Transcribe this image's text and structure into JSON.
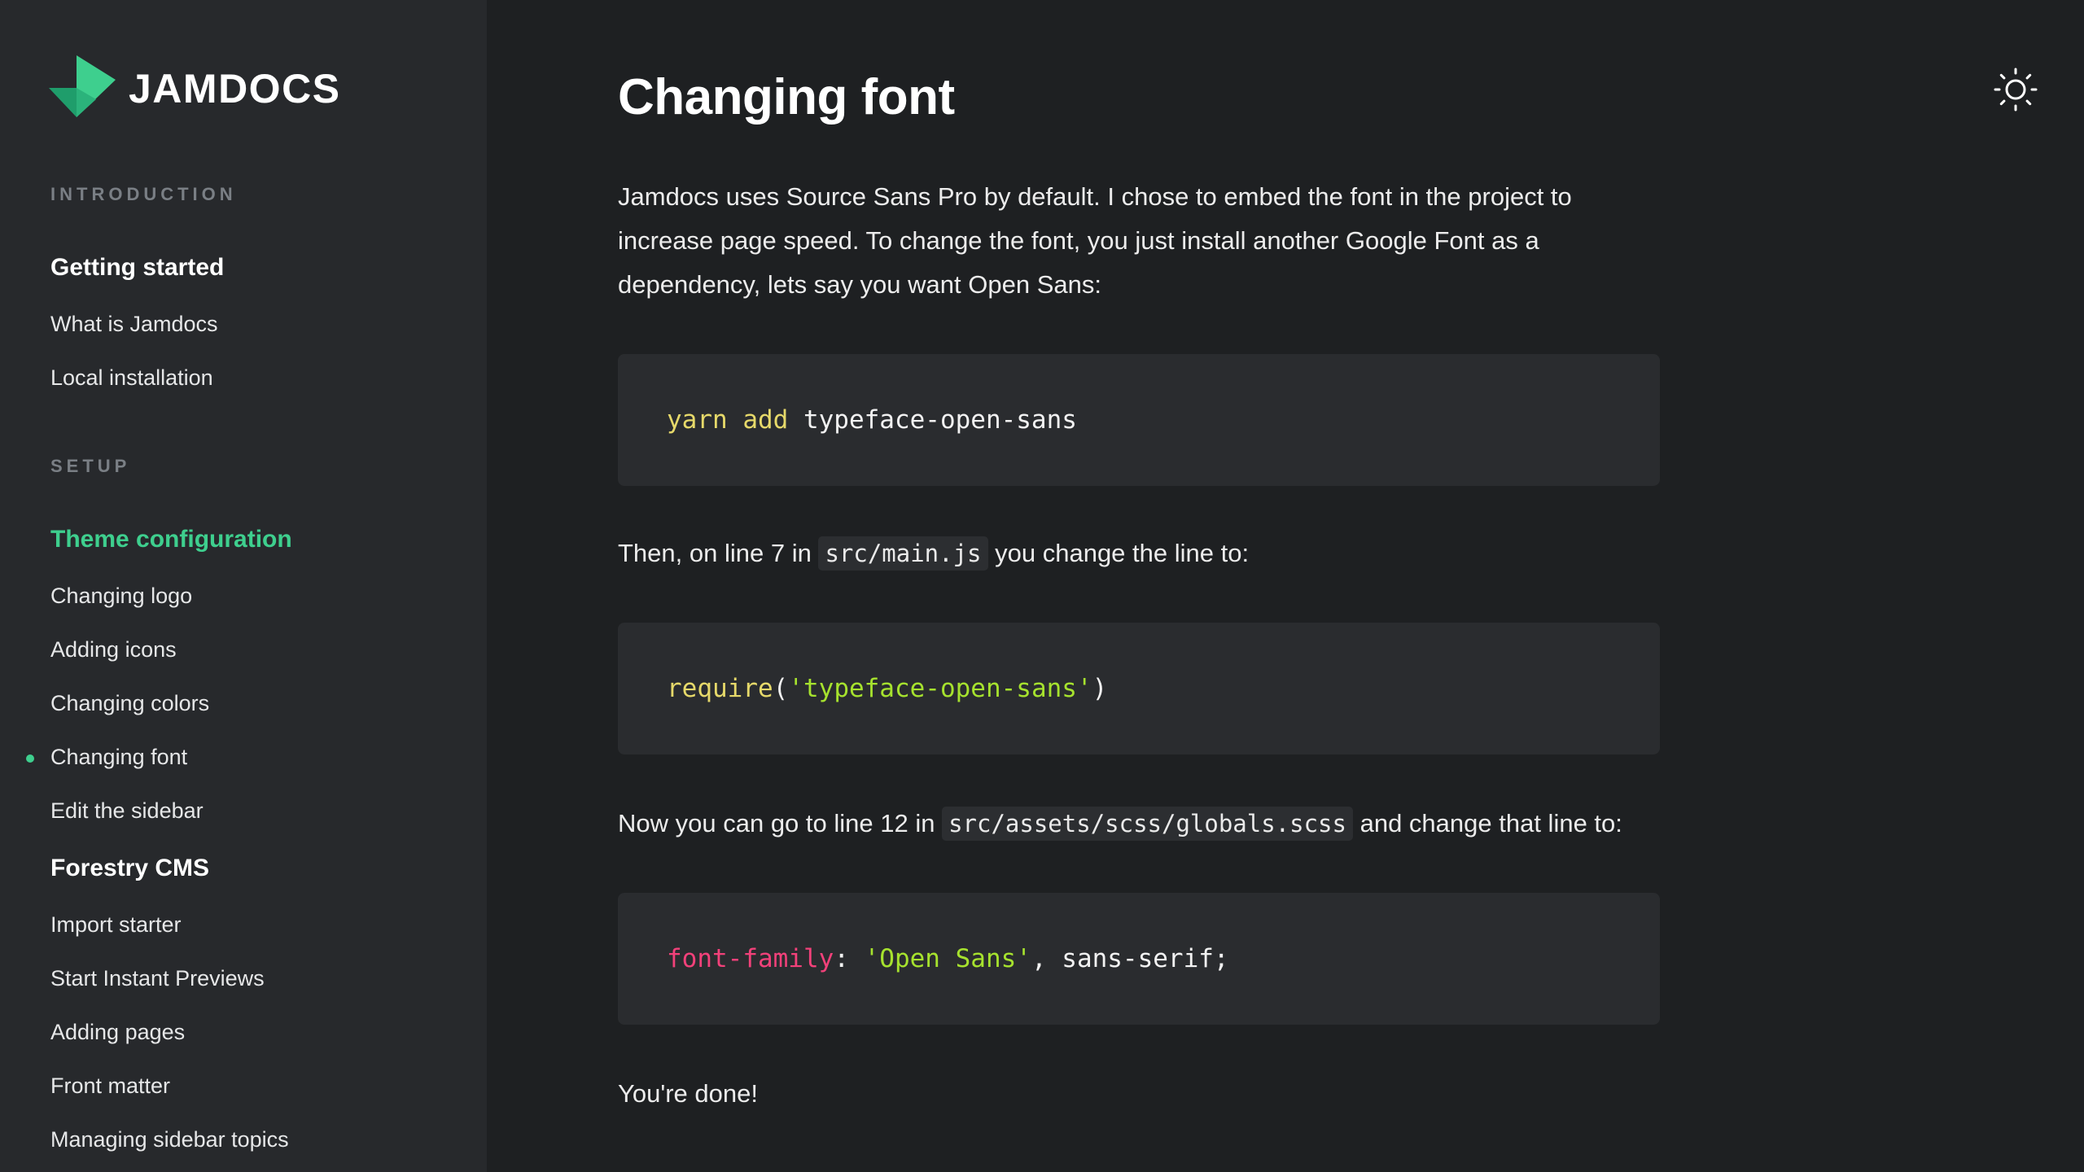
{
  "brand": {
    "name": "JAMDOCS",
    "accent": "#3ecf8e",
    "accent_dark": "#2aa872"
  },
  "sidebar": {
    "sections": [
      {
        "label": "INTRODUCTION",
        "groups": [
          {
            "heading": "Getting started",
            "items": [
              "What is Jamdocs",
              "Local installation"
            ]
          }
        ]
      },
      {
        "label": "SETUP",
        "groups": [
          {
            "heading": "Theme configuration",
            "items": [
              "Changing logo",
              "Adding icons",
              "Changing colors",
              "Changing font",
              "Edit the sidebar"
            ]
          },
          {
            "heading": "Forestry CMS",
            "items": [
              "Import starter",
              "Start Instant Previews",
              "Adding pages",
              "Front matter",
              "Managing sidebar topics"
            ]
          }
        ]
      }
    ],
    "active_item": "Changing font",
    "active_group": "Theme configuration"
  },
  "theme_toggle": {
    "icon": "sun-icon"
  },
  "content": {
    "title": "Changing font",
    "intro": "Jamdocs uses Source Sans Pro by default. I chose to embed the font in the project to increase page speed. To change the font, you just install another Google Font as a dependency, lets say you want Open Sans:",
    "code1": {
      "cmd": "yarn add",
      "arg": " typeface-open-sans"
    },
    "step2": {
      "before": "Then, on line 7 in ",
      "code": "src/main.js",
      "after": " you change the line to:"
    },
    "code2": {
      "fn": "require",
      "open": "(",
      "str": "'typeface-open-sans'",
      "close": ")"
    },
    "step3": {
      "before": "Now you can go to line 12 in ",
      "code": "src/assets/scss/globals.scss",
      "after": " and change that line to:"
    },
    "code3": {
      "prop": "font-family",
      "colon": ": ",
      "str": "'Open Sans'",
      "rest": ", sans-serif;"
    },
    "outro": "You're done!"
  }
}
